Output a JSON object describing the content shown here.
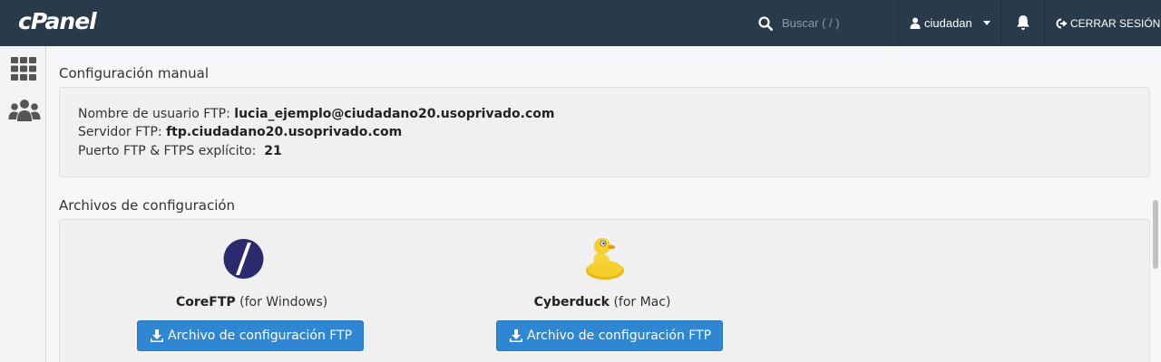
{
  "header": {
    "logo_text": "cPanel",
    "search_placeholder": "Buscar ( / )",
    "username": "ciudadan",
    "logout_label": "CERRAR SESIÓN"
  },
  "sidebar": {
    "items": [
      {
        "icon": "grid-icon"
      },
      {
        "icon": "users-icon"
      }
    ]
  },
  "manual_config": {
    "title": "Configuración manual",
    "username_label": "Nombre de usuario FTP:",
    "username_value": "lucia_ejemplo@ciudadano20.usoprivado.com",
    "server_label": "Servidor FTP:",
    "server_value": "ftp.ciudadano20.usoprivado.com",
    "port_label": "Puerto FTP & FTPS explícito:",
    "port_value": "21"
  },
  "config_files": {
    "title": "Archivos de configuración",
    "clients": [
      {
        "name": "CoreFTP",
        "platform": "(for Windows)",
        "button_label": "Archivo de configuración FTP",
        "icon": "coreftp-logo-icon"
      },
      {
        "name": "Cyberduck",
        "platform": "(for Mac)",
        "button_label": "Archivo de configuración FTP",
        "icon": "cyberduck-logo-icon"
      }
    ]
  },
  "colors": {
    "topbar": "#293a4a",
    "button": "#2f87d4",
    "coreftp": "#2b2a6e",
    "duck": "#f2c81e"
  }
}
